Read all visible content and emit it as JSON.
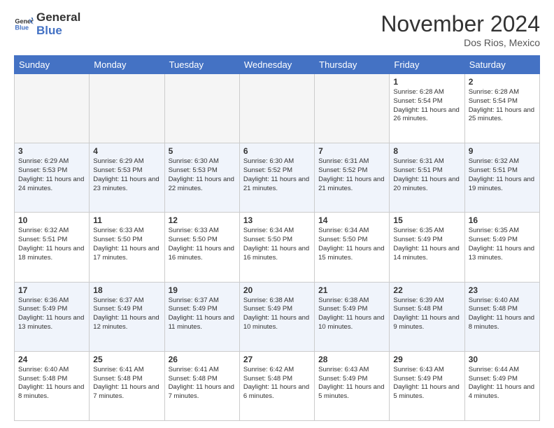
{
  "header": {
    "logo_general": "General",
    "logo_blue": "Blue",
    "month_title": "November 2024",
    "location": "Dos Rios, Mexico"
  },
  "weekdays": [
    "Sunday",
    "Monday",
    "Tuesday",
    "Wednesday",
    "Thursday",
    "Friday",
    "Saturday"
  ],
  "weeks": [
    [
      {
        "day": "",
        "empty": true
      },
      {
        "day": "",
        "empty": true
      },
      {
        "day": "",
        "empty": true
      },
      {
        "day": "",
        "empty": true
      },
      {
        "day": "",
        "empty": true
      },
      {
        "day": "1",
        "sunrise": "6:28 AM",
        "sunset": "5:54 PM",
        "daylight": "11 hours and 26 minutes."
      },
      {
        "day": "2",
        "sunrise": "6:28 AM",
        "sunset": "5:54 PM",
        "daylight": "11 hours and 25 minutes."
      }
    ],
    [
      {
        "day": "3",
        "sunrise": "6:29 AM",
        "sunset": "5:53 PM",
        "daylight": "11 hours and 24 minutes."
      },
      {
        "day": "4",
        "sunrise": "6:29 AM",
        "sunset": "5:53 PM",
        "daylight": "11 hours and 23 minutes."
      },
      {
        "day": "5",
        "sunrise": "6:30 AM",
        "sunset": "5:53 PM",
        "daylight": "11 hours and 22 minutes."
      },
      {
        "day": "6",
        "sunrise": "6:30 AM",
        "sunset": "5:52 PM",
        "daylight": "11 hours and 21 minutes."
      },
      {
        "day": "7",
        "sunrise": "6:31 AM",
        "sunset": "5:52 PM",
        "daylight": "11 hours and 21 minutes."
      },
      {
        "day": "8",
        "sunrise": "6:31 AM",
        "sunset": "5:51 PM",
        "daylight": "11 hours and 20 minutes."
      },
      {
        "day": "9",
        "sunrise": "6:32 AM",
        "sunset": "5:51 PM",
        "daylight": "11 hours and 19 minutes."
      }
    ],
    [
      {
        "day": "10",
        "sunrise": "6:32 AM",
        "sunset": "5:51 PM",
        "daylight": "11 hours and 18 minutes."
      },
      {
        "day": "11",
        "sunrise": "6:33 AM",
        "sunset": "5:50 PM",
        "daylight": "11 hours and 17 minutes."
      },
      {
        "day": "12",
        "sunrise": "6:33 AM",
        "sunset": "5:50 PM",
        "daylight": "11 hours and 16 minutes."
      },
      {
        "day": "13",
        "sunrise": "6:34 AM",
        "sunset": "5:50 PM",
        "daylight": "11 hours and 16 minutes."
      },
      {
        "day": "14",
        "sunrise": "6:34 AM",
        "sunset": "5:50 PM",
        "daylight": "11 hours and 15 minutes."
      },
      {
        "day": "15",
        "sunrise": "6:35 AM",
        "sunset": "5:49 PM",
        "daylight": "11 hours and 14 minutes."
      },
      {
        "day": "16",
        "sunrise": "6:35 AM",
        "sunset": "5:49 PM",
        "daylight": "11 hours and 13 minutes."
      }
    ],
    [
      {
        "day": "17",
        "sunrise": "6:36 AM",
        "sunset": "5:49 PM",
        "daylight": "11 hours and 13 minutes."
      },
      {
        "day": "18",
        "sunrise": "6:37 AM",
        "sunset": "5:49 PM",
        "daylight": "11 hours and 12 minutes."
      },
      {
        "day": "19",
        "sunrise": "6:37 AM",
        "sunset": "5:49 PM",
        "daylight": "11 hours and 11 minutes."
      },
      {
        "day": "20",
        "sunrise": "6:38 AM",
        "sunset": "5:49 PM",
        "daylight": "11 hours and 10 minutes."
      },
      {
        "day": "21",
        "sunrise": "6:38 AM",
        "sunset": "5:49 PM",
        "daylight": "11 hours and 10 minutes."
      },
      {
        "day": "22",
        "sunrise": "6:39 AM",
        "sunset": "5:48 PM",
        "daylight": "11 hours and 9 minutes."
      },
      {
        "day": "23",
        "sunrise": "6:40 AM",
        "sunset": "5:48 PM",
        "daylight": "11 hours and 8 minutes."
      }
    ],
    [
      {
        "day": "24",
        "sunrise": "6:40 AM",
        "sunset": "5:48 PM",
        "daylight": "11 hours and 8 minutes."
      },
      {
        "day": "25",
        "sunrise": "6:41 AM",
        "sunset": "5:48 PM",
        "daylight": "11 hours and 7 minutes."
      },
      {
        "day": "26",
        "sunrise": "6:41 AM",
        "sunset": "5:48 PM",
        "daylight": "11 hours and 7 minutes."
      },
      {
        "day": "27",
        "sunrise": "6:42 AM",
        "sunset": "5:48 PM",
        "daylight": "11 hours and 6 minutes."
      },
      {
        "day": "28",
        "sunrise": "6:43 AM",
        "sunset": "5:49 PM",
        "daylight": "11 hours and 5 minutes."
      },
      {
        "day": "29",
        "sunrise": "6:43 AM",
        "sunset": "5:49 PM",
        "daylight": "11 hours and 5 minutes."
      },
      {
        "day": "30",
        "sunrise": "6:44 AM",
        "sunset": "5:49 PM",
        "daylight": "11 hours and 4 minutes."
      }
    ]
  ],
  "labels": {
    "sunrise": "Sunrise:",
    "sunset": "Sunset:",
    "daylight": "Daylight:"
  }
}
